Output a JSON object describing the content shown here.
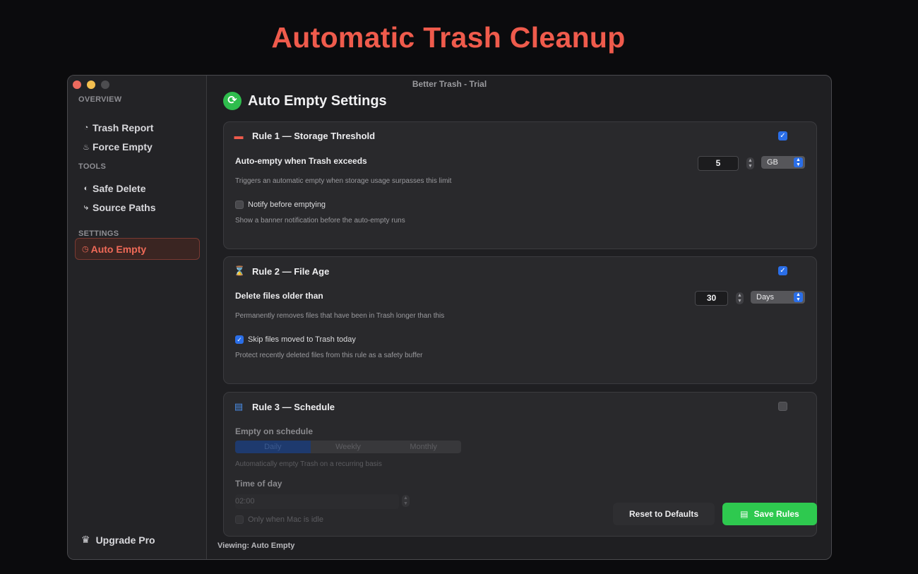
{
  "hero_title": "Automatic Trash Cleanup",
  "window": {
    "title": "Better Trash - Trial"
  },
  "sidebar": {
    "sections": {
      "overview": "OVERVIEW",
      "tools": "TOOLS",
      "settings": "SETTINGS"
    },
    "items": [
      {
        "label": "Trash Report",
        "icon": "pie-chart-icon",
        "glyph": "◔"
      },
      {
        "label": "Force Empty",
        "icon": "flame-icon",
        "glyph": "♨"
      },
      {
        "label": "Safe Delete",
        "icon": "shield-icon",
        "glyph": "◐"
      },
      {
        "label": "Source Paths",
        "icon": "path-icon",
        "glyph": "⤷"
      },
      {
        "label": "Auto Empty",
        "icon": "clock-icon",
        "glyph": "◷",
        "active": true
      }
    ],
    "upgrade": {
      "label": "Upgrade Pro",
      "glyph": "♛"
    }
  },
  "main": {
    "title": "Auto Empty Settings",
    "title_glyph": "⟳",
    "rules": [
      {
        "title": "Rule 1 — Storage Threshold",
        "glyph": "▬",
        "enabled": "✓",
        "field_label": "Auto-empty when Trash exceeds",
        "value": "5",
        "unit": "GB",
        "hint": "Triggers an automatic empty when storage usage surpasses this limit",
        "option_label": "Notify before emptying",
        "option_hint": "Show a banner notification before the auto-empty runs"
      },
      {
        "title": "Rule 2 — File Age",
        "glyph": "⌛",
        "enabled": "✓",
        "field_label": "Delete files older than",
        "value": "30",
        "unit": "Days",
        "hint": "Permanently removes files that have been in Trash longer than this",
        "option_label": "Skip files moved to Trash today",
        "option_check": "✓",
        "option_hint": "Protect recently deleted files from this rule as a safety buffer"
      },
      {
        "title": "Rule 3 — Schedule",
        "glyph": "▤",
        "field_label": "Empty on schedule",
        "segments": [
          "Daily",
          "Weekly",
          "Monthly"
        ],
        "hint": "Automatically empty Trash on a recurring basis",
        "time_label": "Time of day",
        "time_value": "02:00",
        "option_label": "Only when Mac is idle"
      }
    ],
    "buttons": {
      "reset": "Reset to Defaults",
      "save": "Save Rules",
      "save_glyph": "▤"
    },
    "status": "Viewing: Auto Empty"
  },
  "colors": {
    "accent_red": "#ef5b4c",
    "accent_green": "#2ec94f",
    "accent_blue": "#2a6ee8"
  }
}
